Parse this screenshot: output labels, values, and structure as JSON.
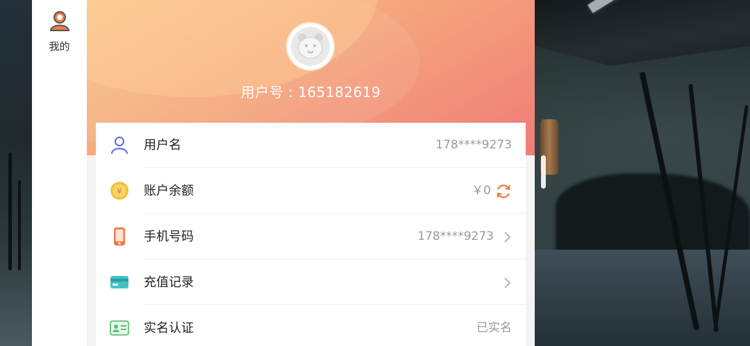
{
  "nav": {
    "items": [
      {
        "label": "我的",
        "icon": "user-icon"
      }
    ]
  },
  "profile": {
    "uid_text": "用户号 : 165182619",
    "avatar_icon": "tiger-avatar-icon"
  },
  "account": {
    "rows": [
      {
        "label": "用户名",
        "value": "178****9273",
        "icon": "person-icon",
        "action": ""
      },
      {
        "label": "账户余额",
        "value": "￥0",
        "icon": "coin-icon",
        "action": "refresh-icon"
      },
      {
        "label": "手机号码",
        "value": "178****9273",
        "icon": "phone-icon",
        "action": "chevron-right-icon"
      },
      {
        "label": "充值记录",
        "value": "",
        "icon": "card-icon",
        "action": "chevron-right-icon"
      },
      {
        "label": "实名认证",
        "value": "已实名",
        "icon": "id-card-icon",
        "action": ""
      }
    ]
  },
  "colors": {
    "header_start": "#f8c889",
    "header_end": "#ef7c78",
    "accent_orange": "#f07b4a",
    "icon_blue": "#6a74d8",
    "icon_gold": "#f3c23a",
    "icon_teal": "#45c1c8",
    "icon_green": "#5cc07a"
  }
}
